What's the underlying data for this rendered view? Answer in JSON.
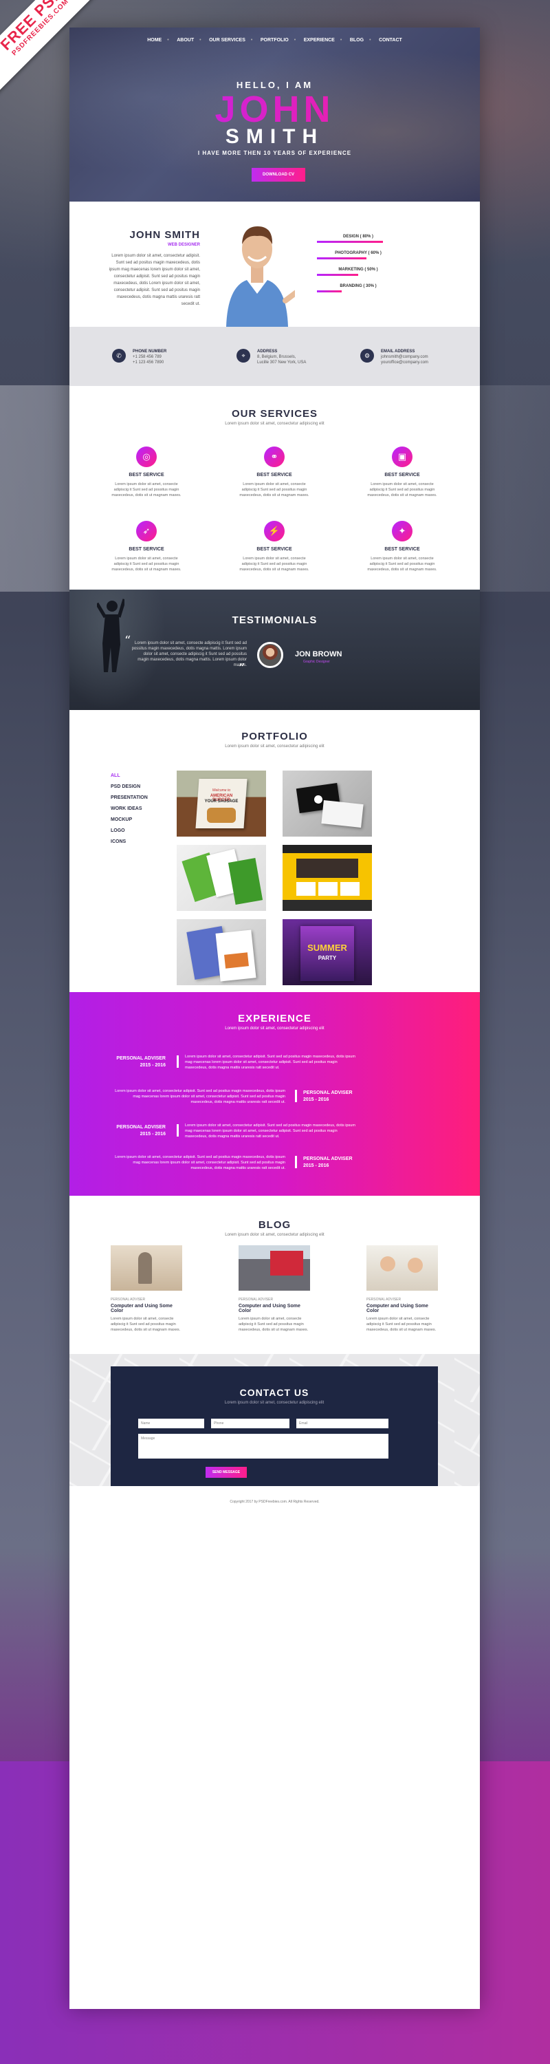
{
  "ribbon": {
    "line1": "FREE PSD",
    "line2": "PSDFREEBIES.COM"
  },
  "nav": [
    "HOME",
    "ABOUT",
    "OUR SERVICES",
    "PORTFOLIO",
    "EXPERIENCE",
    "BLOG",
    "CONTACT"
  ],
  "hero": {
    "hello": "HELLO, I AM",
    "first": "JOHN",
    "last": "SMITH",
    "experience": "I HAVE MORE THEN 10 YEARS OF EXPERIENCE",
    "cv_button": "DOWNLOAD CV"
  },
  "about": {
    "name": "JOHN SMITH",
    "role": "WEB DESIGNER",
    "text": "Lorem ipsum dolor sit amet, consectetur adipisit. Sunt sed ad positus magin maxecedeus, dotis ipsum mag maecenas lorem ipsum dolor sit amet, consectetur adipisit. Sunt sed ad positus magin maxecedeus, dotis Lorem ipsum dolor sit amet, consectetur adipisit. Sunt sed ad positus magin maxecedeus, dotis magna mattis uraresis ratt secedit ut.",
    "skills": [
      {
        "label": "DESIGN ( 80% )",
        "value": 0.8
      },
      {
        "label": "PHOTOGRAPHY ( 60% )",
        "value": 0.6
      },
      {
        "label": "MARKETING ( 50% )",
        "value": 0.5
      },
      {
        "label": "BRANDING ( 30% )",
        "value": 0.3
      }
    ]
  },
  "contact_info": [
    {
      "icon": "phone-icon",
      "glyph": "✆",
      "title": "PHONE NUMBER",
      "line1": "+1 258 456 789",
      "line2": "+1 123 456 7890"
    },
    {
      "icon": "location-icon",
      "glyph": "⌖",
      "title": "ADDRESS",
      "line1": "8, Belgium, Brussels,",
      "line2": "Lucille 307 New York, USA"
    },
    {
      "icon": "share-icon",
      "glyph": "⚙",
      "title": "EMAIL ADDRESS",
      "line1": "johnsmith@company.com",
      "line2": "youroffice@company.com"
    }
  ],
  "services": {
    "title": "OUR SERVICES",
    "subtitle": "Lorem ipsum dolor sit amet, consectetur adipiscing elit",
    "items": [
      {
        "icon": "target-icon",
        "glyph": "◎",
        "title": "BEST SERVICE",
        "text": "Lorem ipsum dolor sit amet, consecte adipiscig it Sunt sed ad possitus magin maxecedeus, dotis sit ut magnam maxes."
      },
      {
        "icon": "link-icon",
        "glyph": "⚭",
        "title": "BEST SERVICE",
        "text": "Lorem ipsum dolor sit amet, consecte adipiscig it Sunt sed ad possitus magin maxecedeus, dotis sit ut magnam maxes."
      },
      {
        "icon": "picture-icon",
        "glyph": "▣",
        "title": "BEST SERVICE",
        "text": "Lorem ipsum dolor sit amet, consecte adipiscig it Sunt sed ad possitus magin maxecedeus, dotis sit ut magnam maxes."
      },
      {
        "icon": "rocket-icon",
        "glyph": "➶",
        "title": "BEST SERVICE",
        "text": "Lorem ipsum dolor sit amet, consecte adipiscig it Sunt sed ad possitus magin maxecedeus, dotis sit ut magnam maxes."
      },
      {
        "icon": "plug-icon",
        "glyph": "⚡",
        "title": "BEST SERVICE",
        "text": "Lorem ipsum dolor sit amet, consecte adipiscig it Sunt sed ad possitus magin maxecedeus, dotis sit ut magnam maxes."
      },
      {
        "icon": "bulb-icon",
        "glyph": "✦",
        "title": "BEST SERVICE",
        "text": "Lorem ipsum dolor sit amet, consecte adipiscig it Sunt sed ad possitus magin maxecedeus, dotis sit ut magnam maxes."
      }
    ]
  },
  "testimonials": {
    "title": "TESTIMONIALS",
    "text": "Lorem ipsum dolor sit amet, consecte adipiscig it Sunt sed ad possitus magin maxecedeus, dotis magna mattis. Lorem ipsum dolor sit amet, consecte adipiscig it Sunt sed ad possitus magin maxecedeus, dotis magna mattis. Lorem ipsum dolor maxes.",
    "name": "JON BROWN",
    "role": "Graphic Designer"
  },
  "portfolio": {
    "title": "PORTFOLIO",
    "subtitle": "Lorem ipsum dolor sit amet, consectetur adipiscing elit",
    "filters": [
      "ALL",
      "PSD DESIGN",
      "PRESENTATION",
      "WORK IDEAS",
      "MOCKUP",
      "LOGO",
      "ICONS"
    ],
    "tile3_text1": "Welcome to",
    "tile3_text2": "AMERICAN BURGER",
    "tile3_text3": "YOUR SAUSAGE",
    "summer": "SUMMER",
    "party": "PARTY"
  },
  "experience": {
    "title": "EXPERIENCE",
    "subtitle": "Lorem ipsum dolor sit amet, consectetur adipiscing elit",
    "items": [
      {
        "job": "PERSONAL ADVISER",
        "years": "2015 - 2016",
        "text": "Lorem ipsum dolor sit amet, consectetur adipisit. Sunt sed ad positus magin maxecedeus, dotis ipsum mag maecenas lorem ipsum dolor sit amet, consectetur adipisit. Sunt sed ad positus magin maxecedeus, dotis magna mattis uraresis ratt secedit ut."
      },
      {
        "job": "PERSONAL ADVISER",
        "years": "2015 - 2016",
        "text": "Lorem ipsum dolor sit amet, consectetur adipisit. Sunt sed ad positus magin maxecedeus, dotis ipsum mag maecenas lorem ipsum dolor sit amet, consectetur adipisit. Sunt sed ad positus magin maxecedeus, dotis magna mattis uraresis ratt secedit ut."
      },
      {
        "job": "PERSONAL ADVISER",
        "years": "2015 - 2016",
        "text": "Lorem ipsum dolor sit amet, consectetur adipisit. Sunt sed ad positus magin maxecedeus, dotis ipsum mag maecenas lorem ipsum dolor sit amet, consectetur adipisit. Sunt sed ad positus magin maxecedeus, dotis magna mattis uraresis ratt secedit ut."
      },
      {
        "job": "PERSONAL ADVISER",
        "years": "2015 - 2016",
        "text": "Lorem ipsum dolor sit amet, consectetur adipisit. Sunt sed ad positus magin maxecedeus, dotis ipsum mag maecenas lorem ipsum dolor sit amet, consectetur adipisit. Sunt sed ad positus magin maxecedeus, dotis magna mattis uraresis ratt secedit ut."
      }
    ]
  },
  "blog": {
    "title": "BLOG",
    "subtitle": "Lorem ipsum dolor sit amet, consectetur adipiscing elit",
    "posts": [
      {
        "category": "PERSONAL ADVISER",
        "title": "Computer and Using Some Color",
        "text": "Lorem ipsum dolor sit amet, consecte adipiscig it Sunt sed ad possitus magin maxecedeus, dotis sit ut magnam maxes."
      },
      {
        "category": "PERSONAL ADVISER",
        "title": "Computer and Using Some Color",
        "text": "Lorem ipsum dolor sit amet, consecte adipiscig it Sunt sed ad possitus magin maxecedeus, dotis sit ut magnam maxes."
      },
      {
        "category": "PERSONAL ADVISER",
        "title": "Computer and Using Some Color",
        "text": "Lorem ipsum dolor sit amet, consecte adipiscig it Sunt sed ad possitus magin maxecedeus, dotis sit ut magnam maxes."
      }
    ]
  },
  "contact": {
    "title": "CONTACT US",
    "subtitle": "Lorem ipsum dolor sit amet, consectetur adipiscing elit",
    "name_placeholder": "Name",
    "phone_placeholder": "Phone",
    "email_placeholder": "Email",
    "message_placeholder": "Message",
    "send": "SEND MESSAGE"
  },
  "footer": "Copyright 2017 by PSDFreebies.com. All Rights Reserved."
}
